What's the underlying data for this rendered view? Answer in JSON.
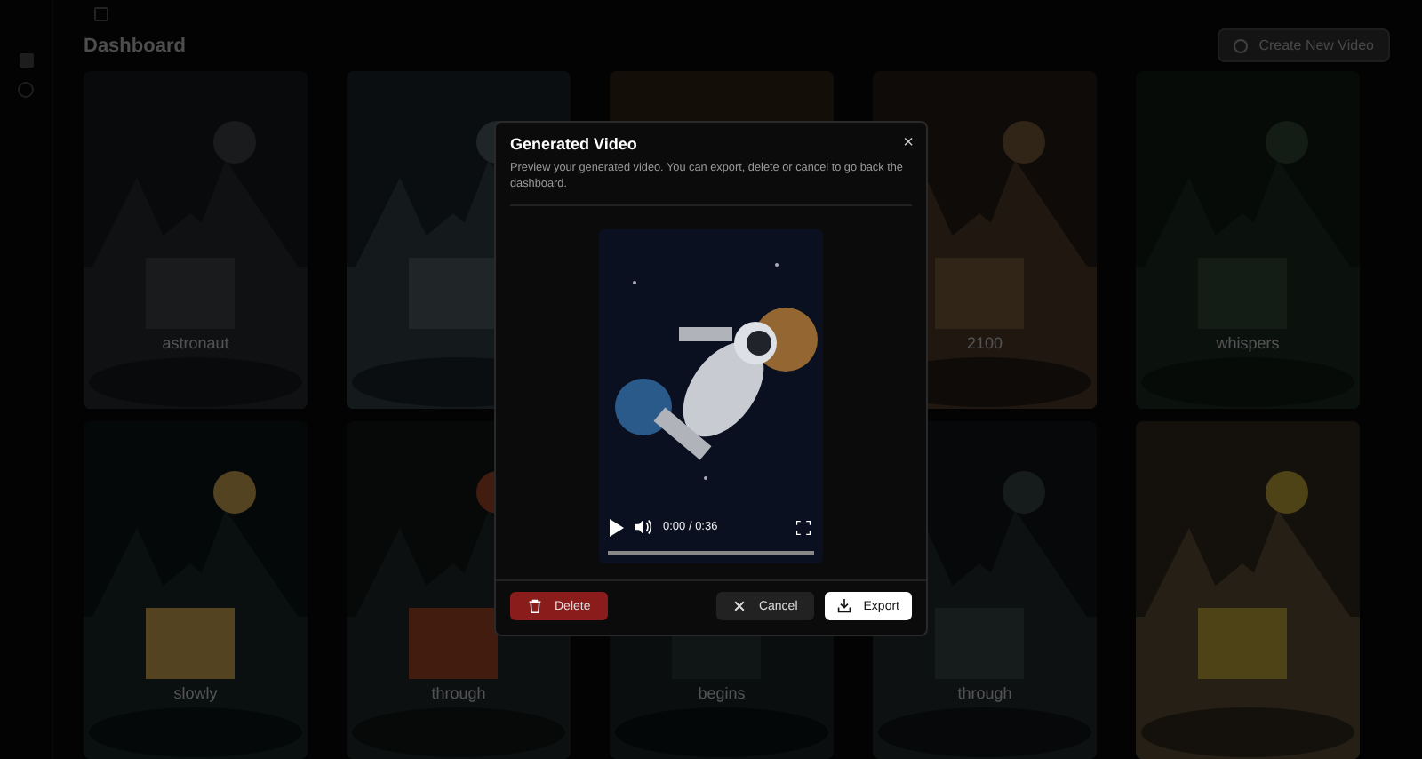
{
  "header": {
    "title": "Dashboard",
    "create_button": "Create New Video"
  },
  "cards": [
    {
      "kind": "picture",
      "label": "astronaut"
    },
    {
      "kind": "picture"
    },
    {
      "kind": "picture"
    },
    {
      "kind": "picture",
      "label": "2100"
    },
    {
      "kind": "picture",
      "label": "whispers"
    },
    {
      "kind": "picture",
      "label": "slowly"
    },
    {
      "kind": "picture",
      "label": "through"
    },
    {
      "kind": "picture",
      "label": "begins"
    },
    {
      "kind": "picture",
      "label": "through"
    },
    {
      "kind": "picture"
    }
  ],
  "dialog": {
    "title": "Generated Video",
    "description": "Preview your generated video. You can export, delete or cancel to go back the dashboard.",
    "close": "×",
    "video": {
      "time": "0:00 / 0:36",
      "level": 0
    },
    "buttons": [
      {
        "kind": "delete",
        "label": "Delete"
      },
      {
        "kind": "cancel",
        "label": "Cancel"
      },
      {
        "kind": "export",
        "label": "Export"
      }
    ]
  }
}
